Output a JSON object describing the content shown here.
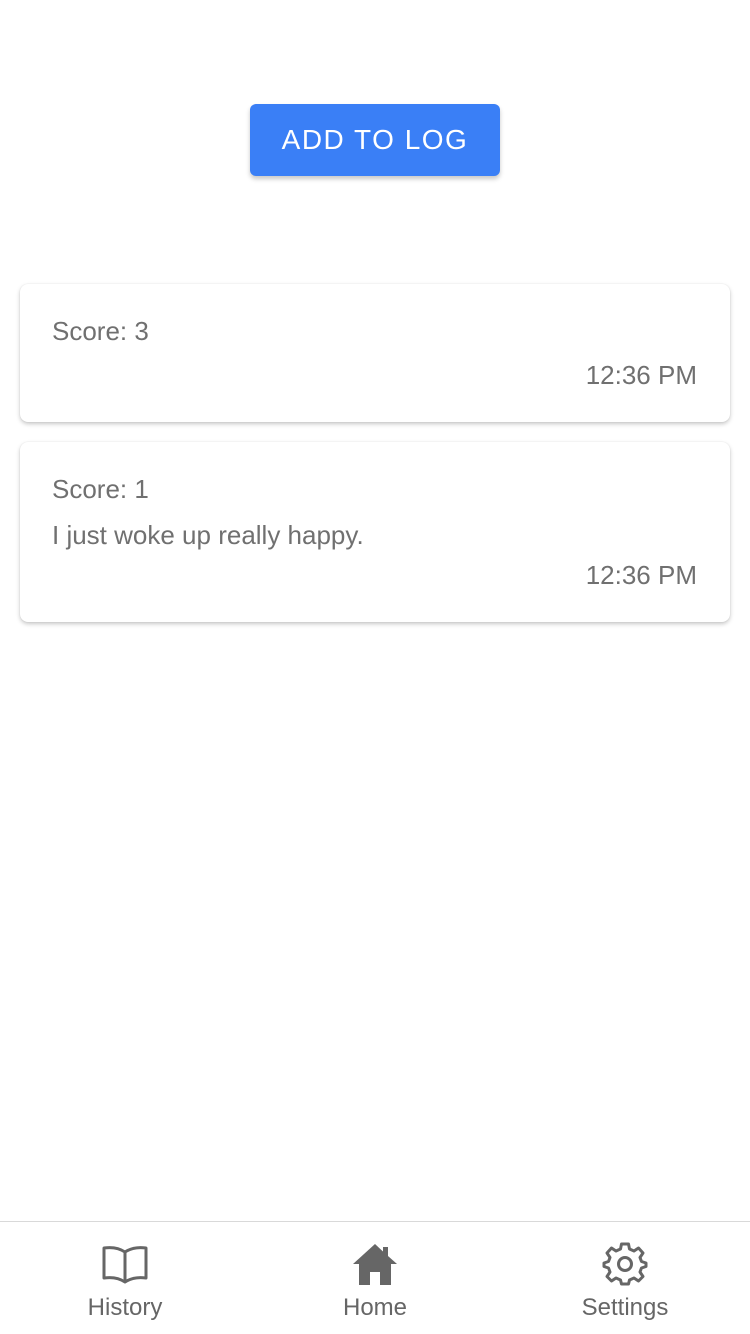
{
  "actions": {
    "add_label": "ADD TO LOG"
  },
  "log": [
    {
      "score": "Score: 3",
      "note": "",
      "time": "12:36 PM"
    },
    {
      "score": "Score: 1",
      "note": "I just woke up really happy.",
      "time": "12:36 PM"
    }
  ],
  "tabs": [
    {
      "label": "History",
      "icon": "book-icon"
    },
    {
      "label": "Home",
      "icon": "home-icon"
    },
    {
      "label": "Settings",
      "icon": "gear-icon"
    }
  ],
  "colors": {
    "accent": "#3a7ff6",
    "text": "#707070",
    "tab_text": "#666666"
  }
}
